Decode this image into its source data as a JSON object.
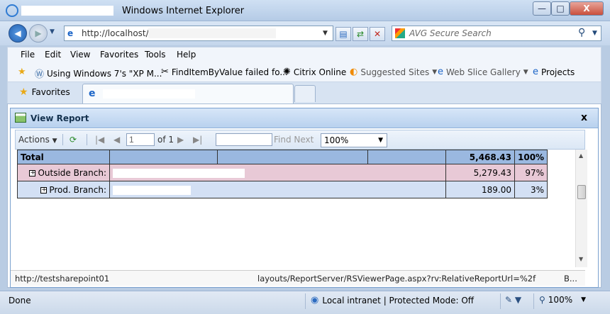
{
  "window": {
    "title": "Windows Internet Explorer",
    "controls": {
      "minimize": "—",
      "maximize": "□",
      "close": "X"
    }
  },
  "address_bar": {
    "url": "http://localhost/",
    "search_placeholder": "AVG Secure Search"
  },
  "menu": [
    "File",
    "Edit",
    "View",
    "Favorites",
    "Tools",
    "Help"
  ],
  "links_bar": [
    {
      "label": "Using Windows 7's \"XP M...",
      "icon": "wordpress-icon"
    },
    {
      "label": "FindItemByValue failed fo...",
      "icon": "tool-icon"
    },
    {
      "label": "Citrix Online",
      "icon": "citrix-icon"
    },
    {
      "label": "Suggested Sites",
      "icon": "suggested-sites-icon"
    },
    {
      "label": "Web Slice Gallery",
      "icon": "ie-page-icon"
    },
    {
      "label": "Projects",
      "icon": "ie-page-icon"
    }
  ],
  "favorites_label": "Favorites",
  "dialog": {
    "title": "View Report",
    "close": "x",
    "toolbar": {
      "actions": "Actions",
      "page_value": "1",
      "of_pages": "of 1",
      "find_next": "Find Next",
      "zoom": "100%"
    },
    "table": {
      "total": {
        "label": "Total",
        "amount": "5,468.43",
        "percent": "100%"
      },
      "rows": [
        {
          "expander": "+",
          "label": "Outside Branch:",
          "amount": "5,279.43",
          "percent": "97%"
        },
        {
          "expander": "+",
          "label": "Prod. Branch:",
          "amount": "189.00",
          "percent": "3%"
        }
      ]
    },
    "hover_url_left": "http://testsharepoint01",
    "hover_url_right": "layouts/ReportServer/RSViewerPage.aspx?rv:RelativeReportUrl=%2f",
    "hover_url_tail": "B..."
  },
  "status": {
    "text": "Done",
    "zone": "Local intranet | Protected Mode: Off",
    "zoom": "100%"
  },
  "colors": {
    "total_row": "#9ab8e0",
    "outside_row": "#e8c9d6",
    "prod_row": "#d3e0f4"
  }
}
